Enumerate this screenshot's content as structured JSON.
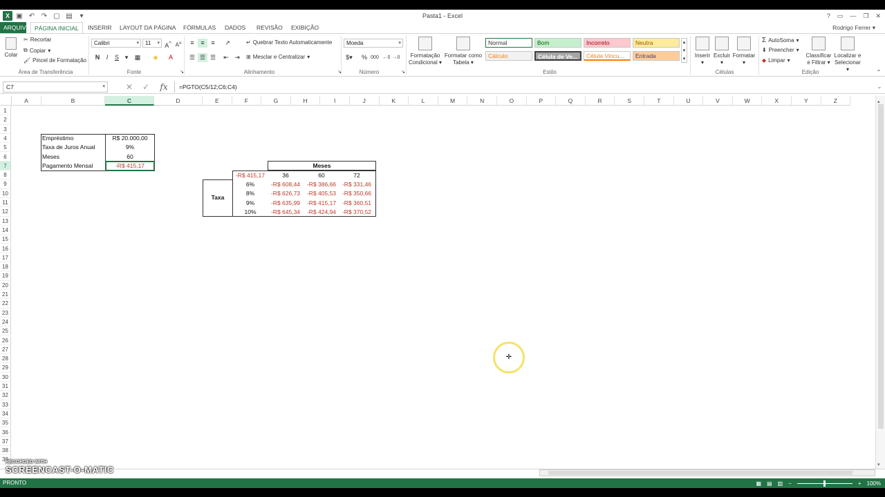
{
  "window": {
    "title": "Pasta1 - Excel",
    "user": "Rodrigo Ferrer",
    "help": "?"
  },
  "tabs": [
    "ARQUIVO",
    "PÁGINA INICIAL",
    "INSERIR",
    "LAYOUT DA PÁGINA",
    "FÓRMULAS",
    "DADOS",
    "REVISÃO",
    "EXIBIÇÃO"
  ],
  "ribbon": {
    "clipboard": {
      "paste": "Colar",
      "cut": "Recortar",
      "copy": "Copiar",
      "format_painter": "Pincel de Formatação",
      "label": "Área de Transferência"
    },
    "font": {
      "name": "Calibri",
      "size": "11",
      "bold": "N",
      "italic": "I",
      "underline": "S",
      "label": "Fonte"
    },
    "alignment": {
      "wrap": "Quebrar Texto Automaticamente",
      "merge": "Mesclar e Centralizar",
      "label": "Alinhamento"
    },
    "number": {
      "format": "Moeda",
      "percent": "%",
      "thousands": "000",
      "label": "Número"
    },
    "styles": {
      "cond_format": "Formatação Condicional",
      "format_table": "Formatar como Tabela",
      "label": "Estilo",
      "cells": [
        {
          "name": "Normal",
          "bg": "#ffffff",
          "fg": "#000000"
        },
        {
          "name": "Bom",
          "bg": "#c6efce",
          "fg": "#006100"
        },
        {
          "name": "Incorreto",
          "bg": "#ffc7ce",
          "fg": "#9c0006"
        },
        {
          "name": "Neutra",
          "bg": "#ffeb9c",
          "fg": "#9c5700"
        },
        {
          "name": "Cálculo",
          "bg": "#f2f2f2",
          "fg": "#fa7d00"
        },
        {
          "name": "Célula de Ve...",
          "bg": "#a5a5a5",
          "fg": "#ffffff"
        },
        {
          "name": "Célula Vincu...",
          "bg": "#ffffff",
          "fg": "#fa7d00"
        },
        {
          "name": "Entrada",
          "bg": "#ffcc99",
          "fg": "#3f3f76"
        }
      ]
    },
    "cells": {
      "insert": "Inserir",
      "delete": "Excluir",
      "format": "Formatar",
      "label": "Células"
    },
    "editing": {
      "autosum": "AutoSoma",
      "fill": "Preencher",
      "clear": "Limpar",
      "sort": "Classificar e Filtrar",
      "find": "Localizar e Selecionar",
      "label": "Edição"
    }
  },
  "formula_bar": {
    "name_box": "C7",
    "formula": "=PGTO(C5/12;C6;C4)",
    "fx": "fx"
  },
  "columns": [
    "A",
    "B",
    "C",
    "D",
    "E",
    "F",
    "G",
    "H",
    "I",
    "J",
    "K",
    "L",
    "M",
    "N",
    "O",
    "P",
    "Q",
    "R",
    "S",
    "T",
    "U",
    "V",
    "W",
    "X",
    "Y",
    "Z"
  ],
  "active_column": "C",
  "active_row": 7,
  "rows": [
    1,
    2,
    3,
    4,
    5,
    6,
    7,
    8,
    9,
    10,
    11,
    12,
    13,
    14,
    15,
    16,
    17,
    18,
    19,
    20,
    21,
    22,
    23,
    24,
    25,
    26,
    27,
    28,
    29,
    30,
    31,
    32,
    33,
    34,
    35,
    36,
    37,
    38,
    39
  ],
  "loan_table": [
    {
      "label": "Empréstimo",
      "value": "R$ 20.000,00"
    },
    {
      "label": "Taxa de Juros Anual",
      "value": "9%"
    },
    {
      "label": "Meses",
      "value": "60"
    },
    {
      "label": "Pagamento Mensal",
      "value": "-R$ 415,17"
    }
  ],
  "data_table": {
    "header": "Meses",
    "row_label": "Taxa",
    "corner": "-R$ 415,17",
    "months": [
      "36",
      "60",
      "72"
    ],
    "rates": [
      "6%",
      "8%",
      "9%",
      "10%"
    ],
    "values": [
      [
        "-R$ 608,44",
        "-R$ 386,66",
        "-R$ 331,46"
      ],
      [
        "-R$ 626,73",
        "-R$ 405,53",
        "-R$ 350,66"
      ],
      [
        "-R$ 635,99",
        "-R$ 415,17",
        "-R$ 360,51"
      ],
      [
        "-R$ 645,34",
        "-R$ 424,94",
        "-R$ 370,52"
      ]
    ]
  },
  "status": {
    "ready": "PRONTO",
    "zoom": "100%"
  },
  "watermark": {
    "line1": "RECORDED WITH",
    "line2": "SCREENCAST-O-MATIC"
  }
}
